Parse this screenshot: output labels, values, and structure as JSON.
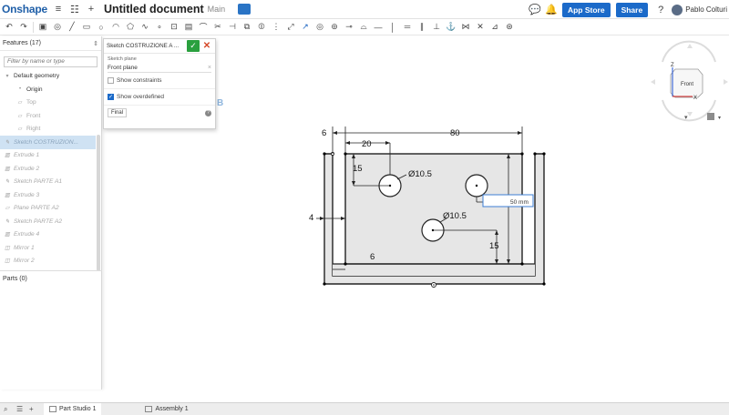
{
  "header": {
    "logo": "Onshape",
    "doc_title": "Untitled document",
    "branch": "Main",
    "app_store": "App Store",
    "share": "Share",
    "user": "Pablo Colturi"
  },
  "features_panel": {
    "title": "Features (17)",
    "filter_placeholder": "Filter by name or type",
    "items": [
      {
        "label": "Default geometry"
      },
      {
        "label": "Origin"
      },
      {
        "label": "Top"
      },
      {
        "label": "Front"
      },
      {
        "label": "Right"
      },
      {
        "label": "Sketch COSTRUZION..."
      },
      {
        "label": "Extrude 1"
      },
      {
        "label": "Extrude 2"
      },
      {
        "label": "Sketch PARTE A1"
      },
      {
        "label": "Extrude 3"
      },
      {
        "label": "Plane PARTE A2"
      },
      {
        "label": "Sketch PARTE A2"
      },
      {
        "label": "Extrude 4"
      },
      {
        "label": "Mirror 1"
      },
      {
        "label": "Mirror 2"
      }
    ],
    "parts": "Parts (0)"
  },
  "sketch_dialog": {
    "title": "Sketch COSTRUZIONE A ...",
    "plane_label": "Sketch plane",
    "plane_value": "Front plane",
    "show_constraints": "Show constraints",
    "show_overdefined": "Show overdefined",
    "final": "Final"
  },
  "viewport": {
    "view_letter": "B",
    "navcube_label": "Front",
    "axis_z": "Z",
    "axis_x": "X",
    "dim_6_left": "6",
    "dim_80": "80",
    "dim_20": "20",
    "dim_15_top": "15",
    "dim_dia_top": "Ø10.5",
    "dim_dia_bottom": "Ø10.5",
    "dim_4": "4",
    "dim_15_bottom": "15",
    "dim_6_bottom": "6",
    "dim_input": "50 mm"
  },
  "bottom_tabs": {
    "part_studio": "Part Studio 1",
    "assembly": "Assembly 1"
  },
  "colors": {
    "accent": "#1b6ac9",
    "logo": "#1f5fa8",
    "ok": "#2aa03e",
    "sketch_fill": "#e6e6e6"
  }
}
